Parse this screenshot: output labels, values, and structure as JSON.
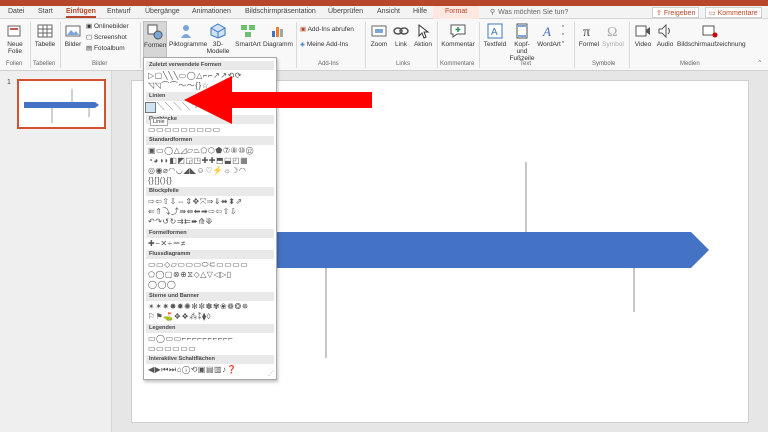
{
  "tabs": [
    "Datei",
    "Start",
    "Einfügen",
    "Entwurf",
    "Übergänge",
    "Animationen",
    "Bildschirmpräsentation",
    "Überprüfen",
    "Ansicht",
    "Hilfe",
    "Format"
  ],
  "active_tab": "Einfügen",
  "tell_me": "Was möchten Sie tun?",
  "share_label": "Freigeben",
  "comments_label": "Kommentare",
  "ribbon": {
    "neue_folie": [
      "Neue",
      "Folie"
    ],
    "tabelle": "Tabelle",
    "bilder": "Bilder",
    "onlinebilder": "Onlinebilder",
    "screenshot": "Screenshot",
    "fotoalbum": "Fotoalbum",
    "formen": "Formen",
    "piktogramme": "Piktogramme",
    "modelle": [
      "3D-",
      "Modelle"
    ],
    "smartart": "SmartArt",
    "diagramm": "Diagramm",
    "addins_abrufen": "Add-Ins abrufen",
    "meine_addins": "Meine Add-Ins",
    "zoom": "Zoom",
    "link": "Link",
    "aktion": "Aktion",
    "kommentar": "Kommentar",
    "textfeld": "Textfeld",
    "kopf_fuss": [
      "Kopf- und",
      "Fußzeile"
    ],
    "wordart": "WordArt",
    "formel": "Formel",
    "symbol": "Symbol",
    "video": "Video",
    "audio": "Audio",
    "bildschirmaufzeichnung": "Bildschirmaufzeichnung"
  },
  "groups": [
    "Folien",
    "Tabellen",
    "Bilder",
    "Add-Ins",
    "Links",
    "Kommentare",
    "Text",
    "Symbole",
    "Medien"
  ],
  "slide_number": "1",
  "dropdown": {
    "sections": [
      "Zuletzt verwendete Formen",
      "Linien",
      "Rechtecke",
      "Standardformen",
      "Blockpfeile",
      "Formelformen",
      "Flussdiagramm",
      "Sterne und Banner",
      "Legenden",
      "Interaktive Schaltflächen"
    ],
    "tooltip": "Linie",
    "rows": {
      "recent": [
        "▷▢╲╲╲▭◯△⌐⌐↗↗⟲⟳",
        "◹◹⌒⌒〜〜{}☆"
      ],
      "lines": [
        "╲╲╲╲╲ㄱㄱ⌐⌐⌐⟆⟆"
      ],
      "rects": [
        "▭▭▭▭▭▭▭▭▭"
      ],
      "basic": [
        "▣▭◯△◿▱⏢⬠⬡⬟⑦⑧⑩⑫",
        "◔◕◑◗◧◩◲◳✚✚⬒⬓◰▦",
        "◎◉⌀◠◡◢◣☺♡⚡☼☽◠",
        "{}[](){}"
      ],
      "block": [
        "⇨⇦⇧⇩⇔⇕✥⤧⇒⇓⬌⬍⇗",
        "⇐⇑⤵⤴⇛⇚⬅➡⇨⇦⇧⇩",
        "↶↷↺↻⇉⇇➨⟰⟱"
      ],
      "equation": [
        "✚−✕÷＝≠"
      ],
      "flow": [
        "▭▭◇▱▭▭▭⬭⊂▭▭▭▭",
        "⬠◯▢⊗⊕⧖◇△▽◁▷▯",
        "◯◯◯"
      ],
      "stars": [
        "✴✶✷✸✹✺✻✼✽✾❀❁❂✵",
        "⚐⚑⛳❖❖⁂⁑⧫◊"
      ],
      "callouts": [
        "▭◯▭▭⌐⌐⌐⌐⌐⌐⌐⌐⌐⌐",
        "▭▭▭▭▭▭"
      ],
      "action": [
        "◀▶⏮⏭⌂ⓘ⟲▣▤▥♪❓"
      ]
    }
  },
  "colors": {
    "accent": "#b7472a",
    "arrow_red": "#ff0000",
    "shape_blue": "#4472c4",
    "line_gray": "#8c8c8c"
  }
}
